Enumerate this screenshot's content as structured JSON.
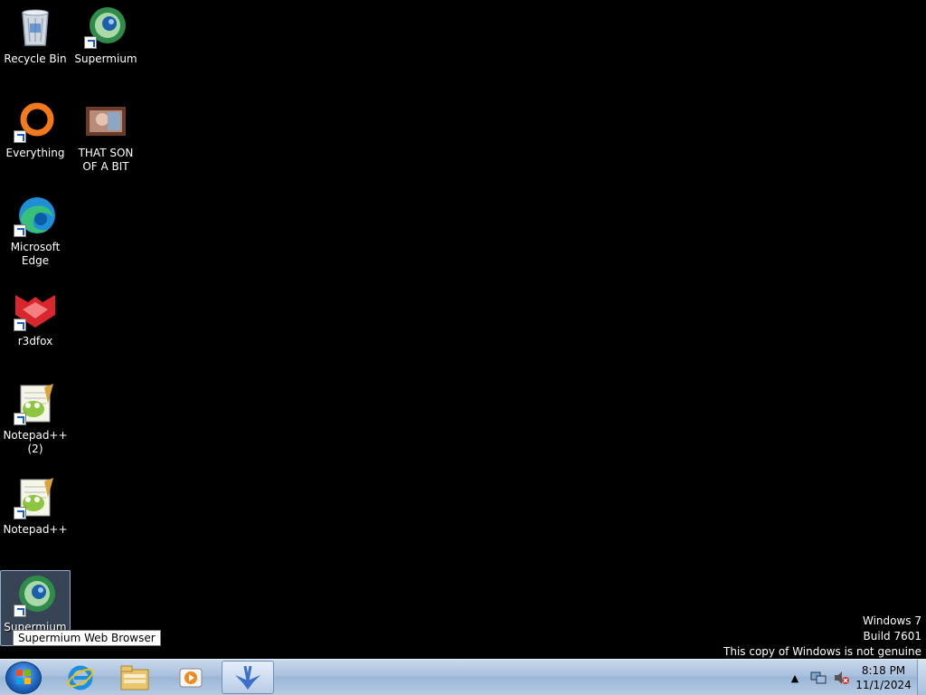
{
  "desktop": {
    "icons": [
      {
        "label": "Recycle Bin",
        "icon": "recycle-bin-icon"
      },
      {
        "label": "Supermium",
        "icon": "supermium-icon"
      },
      {
        "label": "Everything",
        "icon": "everything-icon"
      },
      {
        "label": "THAT SON OF A BIT",
        "icon": "image-thumbnail-icon"
      },
      {
        "label": "Microsoft Edge",
        "icon": "edge-icon"
      },
      {
        "label": "r3dfox",
        "icon": "r3dfox-icon"
      },
      {
        "label": "Notepad++ (2)",
        "icon": "notepadpp-icon"
      },
      {
        "label": "Notepad++",
        "icon": "notepadpp-icon"
      },
      {
        "label": "Supermium",
        "icon": "supermium-icon",
        "selected": true
      }
    ],
    "tooltip": "Supermium Web Browser"
  },
  "watermark": {
    "line1": "Windows 7",
    "line2": "Build 7601",
    "line3": "This copy of Windows is not genuine"
  },
  "taskbar": {
    "pinned": [
      "internet-explorer-icon",
      "windows-explorer-icon",
      "media-player-icon",
      "app-icon"
    ],
    "clock": {
      "time": "8:18 PM",
      "date": "11/1/2024"
    }
  },
  "colors": {
    "desktop": "#000000",
    "taskbar": "#a8c0dd",
    "selection": "#7896be"
  }
}
